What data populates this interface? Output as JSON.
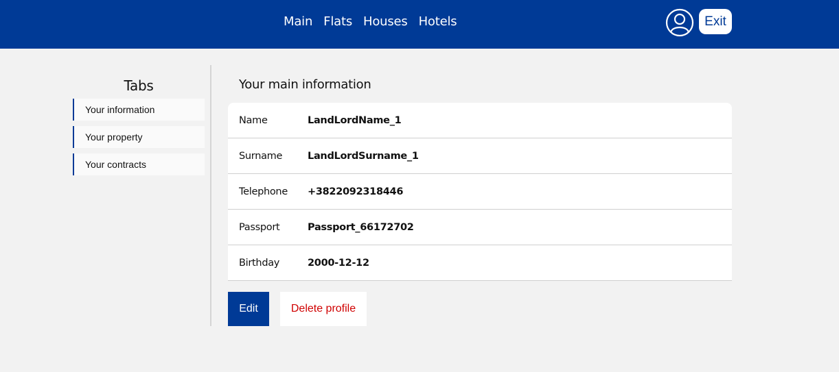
{
  "header": {
    "nav": [
      "Main",
      "Flats",
      "Houses",
      "Hotels"
    ],
    "exit_label": "Exit",
    "avatar_icon": "user-circle-icon"
  },
  "sidebar": {
    "title": "Tabs",
    "items": [
      "Your information",
      "Your property",
      "Your contracts"
    ]
  },
  "main": {
    "title": "Your main information",
    "rows": [
      {
        "label": "Name",
        "value": "LandLordName_1"
      },
      {
        "label": "Surname",
        "value": "LandLordSurname_1"
      },
      {
        "label": "Telephone",
        "value": "+3822092318446"
      },
      {
        "label": "Passport",
        "value": "Passport_66172702"
      },
      {
        "label": "Birthday",
        "value": "2000-12-12"
      }
    ],
    "edit_label": "Edit",
    "delete_label": "Delete profile"
  },
  "colors": {
    "brand": "#003a96",
    "danger": "#d00000",
    "background": "#f2f2f2"
  }
}
